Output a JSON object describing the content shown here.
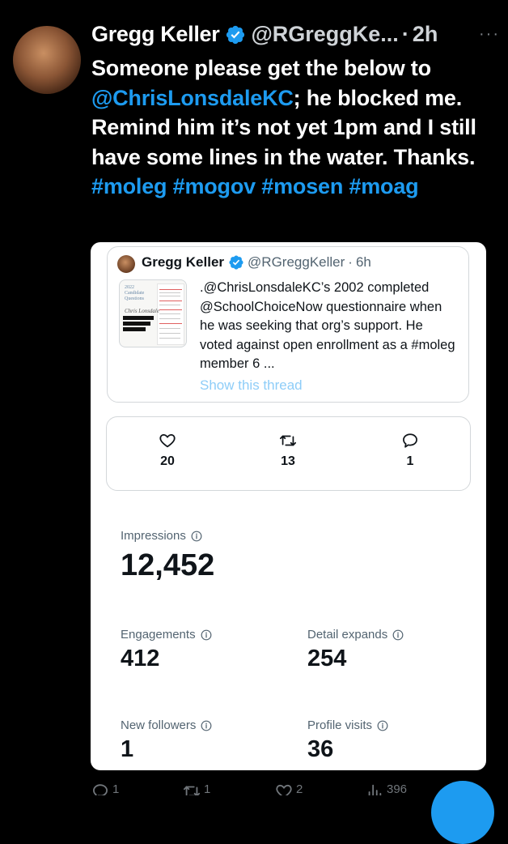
{
  "tweet": {
    "author_name": "Gregg Keller",
    "handle": "@RGreggKe...",
    "separator": "·",
    "time": "2h",
    "more_label": "···",
    "text_parts": [
      "Someone please get the below to ",
      "@ChrisLonsdaleKC",
      "; he blocked me. Remind him it’s not yet 1pm and I still have some lines in the water. Thanks. ",
      "#moleg",
      " ",
      "#mogov",
      " ",
      "#mosen",
      " ",
      "#moag"
    ]
  },
  "quoted": {
    "author_name": "Gregg Keller",
    "handle": "@RGreggKeller",
    "separator": "·",
    "time": "6h",
    "thumbnail_title": "2022 Candidate Questions",
    "thumbnail_signature": "Chris Lonsdale",
    "text": ".@ChrisLonsdaleKC’s 2002 completed @SchoolChoiceNow questionnaire when he was seeking that org’s support. He voted against open enrollment as a #moleg member 6 ...",
    "show_thread": "Show this thread"
  },
  "engagement": {
    "likes": "20",
    "retweets": "13",
    "replies": "1"
  },
  "analytics": {
    "impressions_label": "Impressions",
    "impressions_value": "12,452",
    "engagements_label": "Engagements",
    "engagements_value": "412",
    "detail_expands_label": "Detail expands",
    "detail_expands_value": "254",
    "new_followers_label": "New followers",
    "new_followers_value": "1",
    "profile_visits_label": "Profile visits",
    "profile_visits_value": "36"
  },
  "action_bar": {
    "replies": "1",
    "retweets": "1",
    "likes": "2",
    "views": "396"
  },
  "colors": {
    "background": "#000000",
    "link": "#1d9bf0",
    "card": "#ffffff",
    "secondary_text": "#536471"
  }
}
